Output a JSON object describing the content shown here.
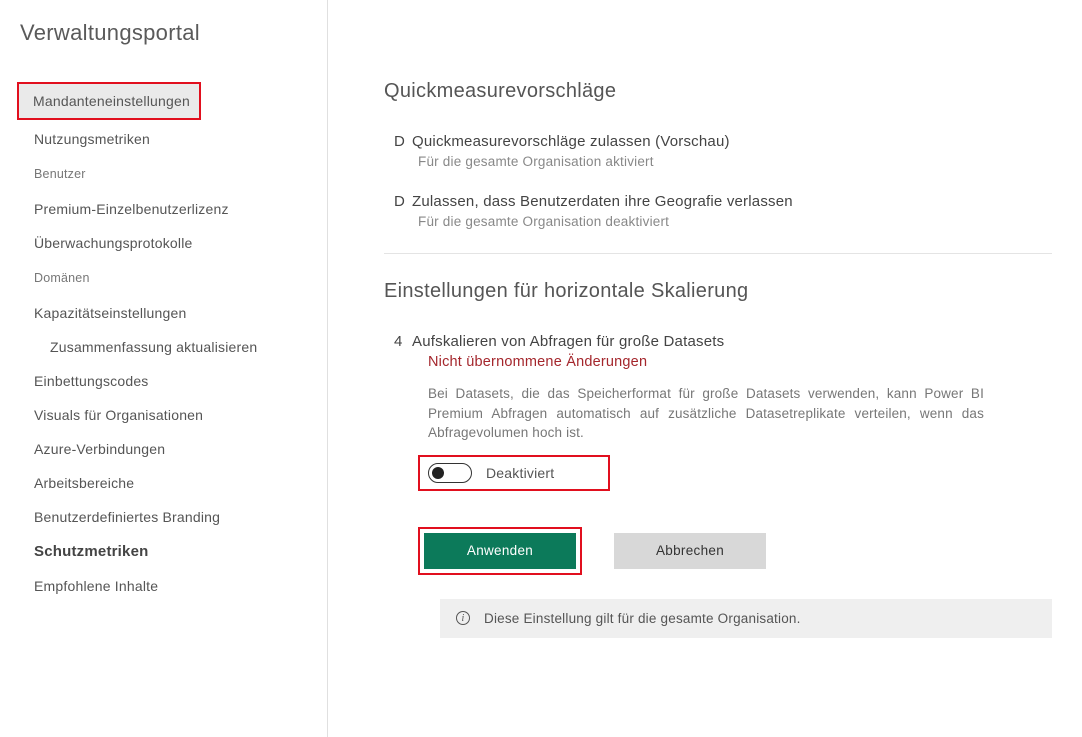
{
  "sidebar": {
    "title": "Verwaltungsportal",
    "items": [
      {
        "label": "Mandanteneinstellungen"
      },
      {
        "label": "Nutzungsmetriken"
      },
      {
        "label": "Benutzer"
      },
      {
        "label": "Premium-Einzelbenutzerlizenz"
      },
      {
        "label": "Überwachungsprotokolle"
      },
      {
        "label": "Domänen"
      },
      {
        "label": "Kapazitätseinstellungen"
      },
      {
        "label": "Zusammenfassung aktualisieren"
      },
      {
        "label": "Einbettungscodes"
      },
      {
        "label": "Visuals für Organisationen"
      },
      {
        "label": "Azure-Verbindungen"
      },
      {
        "label": "Arbeitsbereiche"
      },
      {
        "label": "Benutzerdefiniertes Branding"
      },
      {
        "label": "Schutzmetriken"
      },
      {
        "label": "Empfohlene Inhalte"
      }
    ]
  },
  "section1": {
    "title": "Quickmeasurevorschläge",
    "row1": {
      "bullet": "D",
      "head": "Quickmeasurevorschläge zulassen (Vorschau)",
      "sub": "Für die gesamte Organisation aktiviert"
    },
    "row2": {
      "bullet": "D",
      "head": "Zulassen, dass Benutzerdaten ihre Geografie verlassen",
      "sub": "Für die gesamte Organisation deaktiviert"
    }
  },
  "section2": {
    "title": "Einstellungen für horizontale Skalierung",
    "row": {
      "bullet": "4",
      "head": "Aufskalieren von Abfragen für große Datasets",
      "warn": "Nicht übernommene Änderungen",
      "desc": "Bei Datasets, die das Speicherformat für große Datasets verwenden, kann Power BI Premium Abfragen automatisch auf zusätzliche Datasetreplikate verteilen, wenn das Abfragevolumen hoch ist."
    },
    "toggle": {
      "state": "Deaktiviert"
    },
    "buttons": {
      "apply": "Anwenden",
      "cancel": "Abbrechen"
    },
    "info": "Diese Einstellung gilt für die gesamte Organisation."
  }
}
